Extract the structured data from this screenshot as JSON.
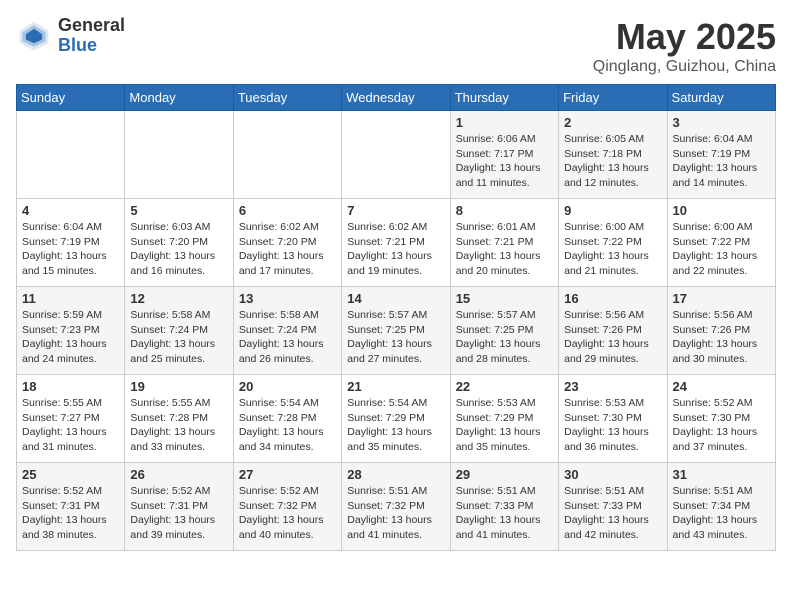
{
  "header": {
    "logo_general": "General",
    "logo_blue": "Blue",
    "title": "May 2025",
    "location": "Qinglang, Guizhou, China"
  },
  "weekdays": [
    "Sunday",
    "Monday",
    "Tuesday",
    "Wednesday",
    "Thursday",
    "Friday",
    "Saturday"
  ],
  "weeks": [
    [
      {
        "day": "",
        "info": ""
      },
      {
        "day": "",
        "info": ""
      },
      {
        "day": "",
        "info": ""
      },
      {
        "day": "",
        "info": ""
      },
      {
        "day": "1",
        "info": "Sunrise: 6:06 AM\nSunset: 7:17 PM\nDaylight: 13 hours\nand 11 minutes."
      },
      {
        "day": "2",
        "info": "Sunrise: 6:05 AM\nSunset: 7:18 PM\nDaylight: 13 hours\nand 12 minutes."
      },
      {
        "day": "3",
        "info": "Sunrise: 6:04 AM\nSunset: 7:19 PM\nDaylight: 13 hours\nand 14 minutes."
      }
    ],
    [
      {
        "day": "4",
        "info": "Sunrise: 6:04 AM\nSunset: 7:19 PM\nDaylight: 13 hours\nand 15 minutes."
      },
      {
        "day": "5",
        "info": "Sunrise: 6:03 AM\nSunset: 7:20 PM\nDaylight: 13 hours\nand 16 minutes."
      },
      {
        "day": "6",
        "info": "Sunrise: 6:02 AM\nSunset: 7:20 PM\nDaylight: 13 hours\nand 17 minutes."
      },
      {
        "day": "7",
        "info": "Sunrise: 6:02 AM\nSunset: 7:21 PM\nDaylight: 13 hours\nand 19 minutes."
      },
      {
        "day": "8",
        "info": "Sunrise: 6:01 AM\nSunset: 7:21 PM\nDaylight: 13 hours\nand 20 minutes."
      },
      {
        "day": "9",
        "info": "Sunrise: 6:00 AM\nSunset: 7:22 PM\nDaylight: 13 hours\nand 21 minutes."
      },
      {
        "day": "10",
        "info": "Sunrise: 6:00 AM\nSunset: 7:22 PM\nDaylight: 13 hours\nand 22 minutes."
      }
    ],
    [
      {
        "day": "11",
        "info": "Sunrise: 5:59 AM\nSunset: 7:23 PM\nDaylight: 13 hours\nand 24 minutes."
      },
      {
        "day": "12",
        "info": "Sunrise: 5:58 AM\nSunset: 7:24 PM\nDaylight: 13 hours\nand 25 minutes."
      },
      {
        "day": "13",
        "info": "Sunrise: 5:58 AM\nSunset: 7:24 PM\nDaylight: 13 hours\nand 26 minutes."
      },
      {
        "day": "14",
        "info": "Sunrise: 5:57 AM\nSunset: 7:25 PM\nDaylight: 13 hours\nand 27 minutes."
      },
      {
        "day": "15",
        "info": "Sunrise: 5:57 AM\nSunset: 7:25 PM\nDaylight: 13 hours\nand 28 minutes."
      },
      {
        "day": "16",
        "info": "Sunrise: 5:56 AM\nSunset: 7:26 PM\nDaylight: 13 hours\nand 29 minutes."
      },
      {
        "day": "17",
        "info": "Sunrise: 5:56 AM\nSunset: 7:26 PM\nDaylight: 13 hours\nand 30 minutes."
      }
    ],
    [
      {
        "day": "18",
        "info": "Sunrise: 5:55 AM\nSunset: 7:27 PM\nDaylight: 13 hours\nand 31 minutes."
      },
      {
        "day": "19",
        "info": "Sunrise: 5:55 AM\nSunset: 7:28 PM\nDaylight: 13 hours\nand 33 minutes."
      },
      {
        "day": "20",
        "info": "Sunrise: 5:54 AM\nSunset: 7:28 PM\nDaylight: 13 hours\nand 34 minutes."
      },
      {
        "day": "21",
        "info": "Sunrise: 5:54 AM\nSunset: 7:29 PM\nDaylight: 13 hours\nand 35 minutes."
      },
      {
        "day": "22",
        "info": "Sunrise: 5:53 AM\nSunset: 7:29 PM\nDaylight: 13 hours\nand 35 minutes."
      },
      {
        "day": "23",
        "info": "Sunrise: 5:53 AM\nSunset: 7:30 PM\nDaylight: 13 hours\nand 36 minutes."
      },
      {
        "day": "24",
        "info": "Sunrise: 5:52 AM\nSunset: 7:30 PM\nDaylight: 13 hours\nand 37 minutes."
      }
    ],
    [
      {
        "day": "25",
        "info": "Sunrise: 5:52 AM\nSunset: 7:31 PM\nDaylight: 13 hours\nand 38 minutes."
      },
      {
        "day": "26",
        "info": "Sunrise: 5:52 AM\nSunset: 7:31 PM\nDaylight: 13 hours\nand 39 minutes."
      },
      {
        "day": "27",
        "info": "Sunrise: 5:52 AM\nSunset: 7:32 PM\nDaylight: 13 hours\nand 40 minutes."
      },
      {
        "day": "28",
        "info": "Sunrise: 5:51 AM\nSunset: 7:32 PM\nDaylight: 13 hours\nand 41 minutes."
      },
      {
        "day": "29",
        "info": "Sunrise: 5:51 AM\nSunset: 7:33 PM\nDaylight: 13 hours\nand 41 minutes."
      },
      {
        "day": "30",
        "info": "Sunrise: 5:51 AM\nSunset: 7:33 PM\nDaylight: 13 hours\nand 42 minutes."
      },
      {
        "day": "31",
        "info": "Sunrise: 5:51 AM\nSunset: 7:34 PM\nDaylight: 13 hours\nand 43 minutes."
      }
    ]
  ]
}
